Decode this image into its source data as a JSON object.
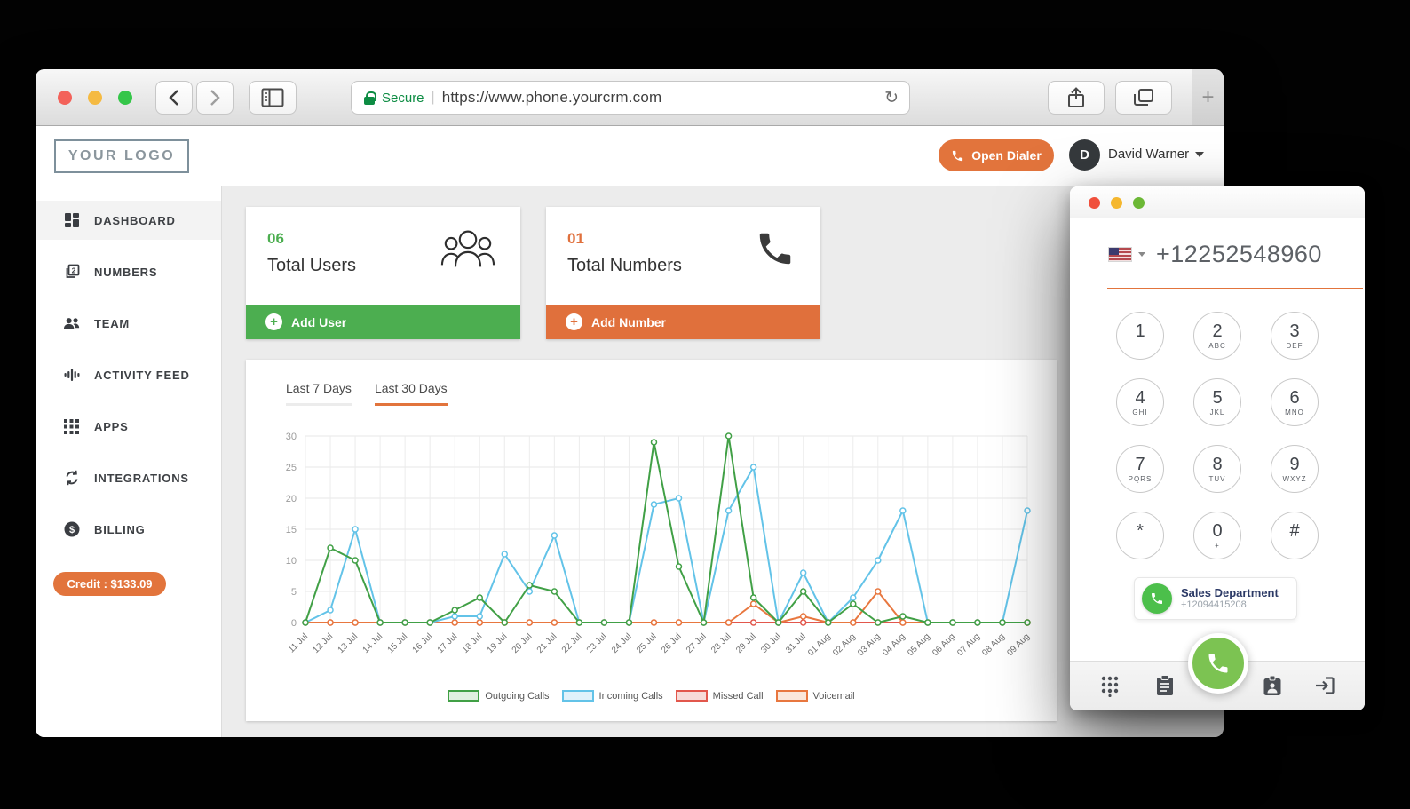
{
  "browser": {
    "secure_label": "Secure",
    "url": "https://www.phone.yourcrm.com",
    "url_separator": "|",
    "new_tab_label": "+",
    "reload_glyph": "↻"
  },
  "header": {
    "logo": "YOUR LOGO",
    "open_dialer_label": "Open Dialer",
    "user_initial": "D",
    "user_name": "David Warner"
  },
  "sidebar": {
    "items": [
      {
        "label": "DASHBOARD",
        "icon": "dashboard-icon",
        "active": true
      },
      {
        "label": "NUMBERS",
        "icon": "numbers-icon",
        "active": false
      },
      {
        "label": "TEAM",
        "icon": "team-icon",
        "active": false
      },
      {
        "label": "ACTIVITY FEED",
        "icon": "activity-icon",
        "active": false
      },
      {
        "label": "APPS",
        "icon": "apps-icon",
        "active": false
      },
      {
        "label": "INTEGRATIONS",
        "icon": "integrations-icon",
        "active": false
      },
      {
        "label": "BILLING",
        "icon": "billing-icon",
        "active": false
      }
    ],
    "credit_label": "Credit : $133.09"
  },
  "cards": {
    "users": {
      "count": "06",
      "label": "Total Users",
      "action": "Add User",
      "accent": "#4cae50",
      "icon": "people-group-icon"
    },
    "numbers": {
      "count": "01",
      "label": "Total Numbers",
      "action": "Add Number",
      "accent": "#e0703c",
      "icon": "phone-icon"
    }
  },
  "chart_tabs": {
    "last7": {
      "label": "Last 7 Days",
      "active": false
    },
    "last30": {
      "label": "Last 30 Days",
      "active": true
    }
  },
  "chart_data": {
    "type": "line",
    "title": "",
    "x_labels": [
      "11 Jul",
      "12 Jul",
      "13 Jul",
      "14 Jul",
      "15 Jul",
      "16 Jul",
      "17 Jul",
      "18 Jul",
      "19 Jul",
      "20 Jul",
      "21 Jul",
      "22 Jul",
      "23 Jul",
      "24 Jul",
      "25 Jul",
      "26 Jul",
      "27 Jul",
      "28 Jul",
      "29 Jul",
      "30 Jul",
      "31 Jul",
      "01 Aug",
      "02 Aug",
      "03 Aug",
      "04 Aug",
      "05 Aug",
      "06 Aug",
      "07 Aug",
      "08 Aug",
      "09 Aug"
    ],
    "ylim": [
      0,
      30
    ],
    "yticks": [
      0,
      5,
      10,
      15,
      20,
      25,
      30
    ],
    "grid": true,
    "legend_position": "bottom",
    "series": [
      {
        "name": "Outgoing Calls",
        "color": "#41a046",
        "swatch_fill": "#e0f0e0",
        "values": [
          0,
          12,
          10,
          0,
          0,
          0,
          2,
          4,
          0,
          6,
          5,
          0,
          0,
          0,
          29,
          9,
          0,
          30,
          4,
          0,
          5,
          0,
          3,
          0,
          1,
          0,
          0,
          0,
          0,
          0
        ]
      },
      {
        "name": "Incoming Calls",
        "color": "#63c3e8",
        "swatch_fill": "#e0f2fb",
        "values": [
          0,
          2,
          15,
          0,
          0,
          0,
          1,
          1,
          11,
          5,
          14,
          0,
          0,
          0,
          19,
          20,
          0,
          18,
          25,
          0,
          8,
          0,
          4,
          10,
          18,
          0,
          0,
          0,
          0,
          18
        ]
      },
      {
        "name": "Missed Call",
        "color": "#e2574c",
        "swatch_fill": "#f7dbd8",
        "values": [
          0,
          0,
          0,
          0,
          0,
          0,
          0,
          0,
          0,
          0,
          0,
          0,
          0,
          0,
          0,
          0,
          0,
          0,
          0,
          0,
          0,
          0,
          0,
          0,
          0,
          0,
          0,
          0,
          0,
          0
        ]
      },
      {
        "name": "Voicemail",
        "color": "#e8773f",
        "swatch_fill": "#fbe7da",
        "values": [
          0,
          0,
          0,
          0,
          0,
          0,
          0,
          0,
          0,
          0,
          0,
          0,
          0,
          0,
          0,
          0,
          0,
          0,
          3,
          0,
          1,
          0,
          0,
          5,
          0,
          0,
          0,
          0,
          0,
          0
        ]
      }
    ],
    "draw_order": [
      2,
      3,
      1,
      0
    ]
  },
  "dialer": {
    "number": "+12252548960",
    "keys": [
      {
        "digit": "1",
        "sub": ""
      },
      {
        "digit": "2",
        "sub": "ABC"
      },
      {
        "digit": "3",
        "sub": "DEF"
      },
      {
        "digit": "4",
        "sub": "GHI"
      },
      {
        "digit": "5",
        "sub": "JKL"
      },
      {
        "digit": "6",
        "sub": "MNO"
      },
      {
        "digit": "7",
        "sub": "PQRS"
      },
      {
        "digit": "8",
        "sub": "TUV"
      },
      {
        "digit": "9",
        "sub": "WXYZ"
      },
      {
        "digit": "*",
        "sub": ""
      },
      {
        "digit": "0",
        "sub": "+"
      },
      {
        "digit": "#",
        "sub": ""
      }
    ],
    "quick_contact": {
      "name": "Sales Department",
      "number": "+12094415208"
    },
    "call_button_color": "#7cc352"
  },
  "colors": {
    "accent_orange": "#e2743c",
    "accent_green": "#4cae50",
    "sidebar_text": "#3e4145"
  }
}
